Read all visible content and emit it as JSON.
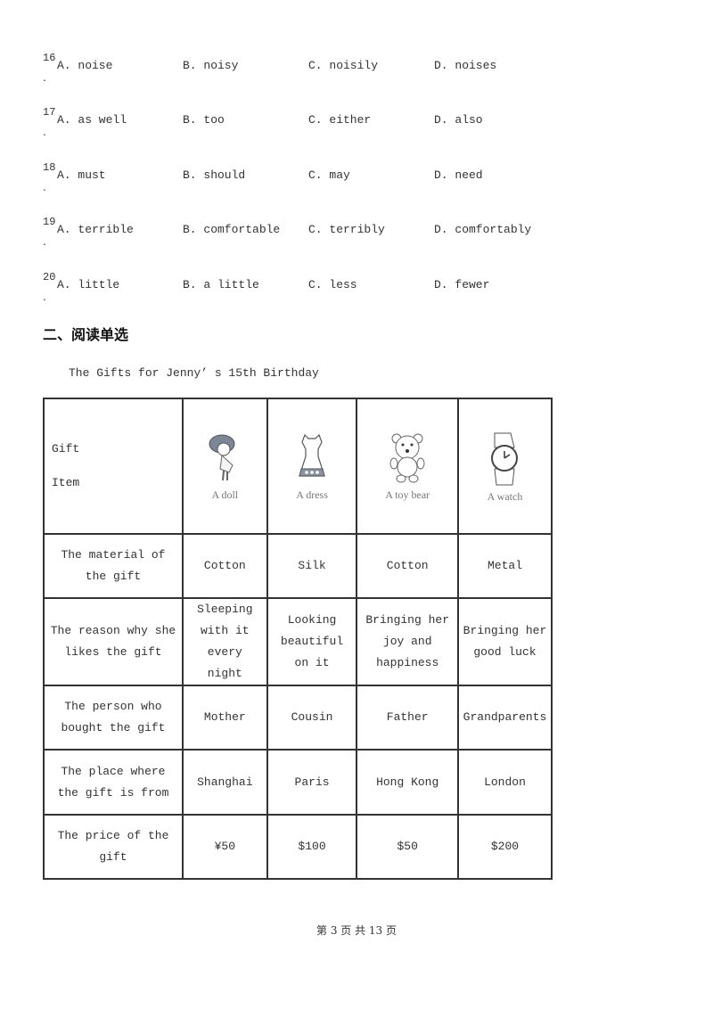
{
  "questions": [
    {
      "num": "16",
      "dot": ".",
      "options": [
        "A. noise",
        "B. noisy",
        "C. noisily",
        "D. noises"
      ]
    },
    {
      "num": "17",
      "dot": ".",
      "options": [
        "A. as well",
        "B. too",
        "C. either",
        "D. also"
      ]
    },
    {
      "num": "18",
      "dot": ".",
      "options": [
        "A. must",
        "B. should",
        "C. may",
        "D. need"
      ]
    },
    {
      "num": "19",
      "dot": ".",
      "options": [
        "A. terrible",
        "B. comfortable",
        "C. terribly",
        "D. comfortably"
      ]
    },
    {
      "num": "20",
      "dot": ".",
      "options": [
        "A. little",
        "B. a little",
        "C. less",
        "D. fewer"
      ]
    }
  ],
  "section_title": "二、阅读单选",
  "passage_title": "The Gifts for Jenny’ s 15th Birthday",
  "table": {
    "header": {
      "label_line1": "Gift",
      "label_line2": "Item",
      "items": [
        {
          "icon": "doll-icon",
          "caption": "A doll"
        },
        {
          "icon": "dress-icon",
          "caption": "A dress"
        },
        {
          "icon": "toy-bear-icon",
          "caption": "A toy bear"
        },
        {
          "icon": "watch-icon",
          "caption": "A watch"
        }
      ]
    },
    "rows": [
      {
        "label": "The material of the gift",
        "cells": [
          "Cotton",
          "Silk",
          "Cotton",
          "Metal"
        ]
      },
      {
        "label": "The reason why she likes the gift",
        "cells": [
          "Sleeping with it every night",
          "Looking beautiful on it",
          "Bringing her joy and happiness",
          "Bringing her good luck"
        ]
      },
      {
        "label": "The person who bought the gift",
        "cells": [
          "Mother",
          "Cousin",
          "Father",
          "Grandparents"
        ]
      },
      {
        "label": "The place where the gift is from",
        "cells": [
          "Shanghai",
          "Paris",
          "Hong Kong",
          "London"
        ]
      },
      {
        "label": "The price of the gift",
        "cells": [
          "¥50",
          "$100",
          "$50",
          "$200"
        ]
      }
    ]
  },
  "footer": "第 3 页 共 13 页"
}
